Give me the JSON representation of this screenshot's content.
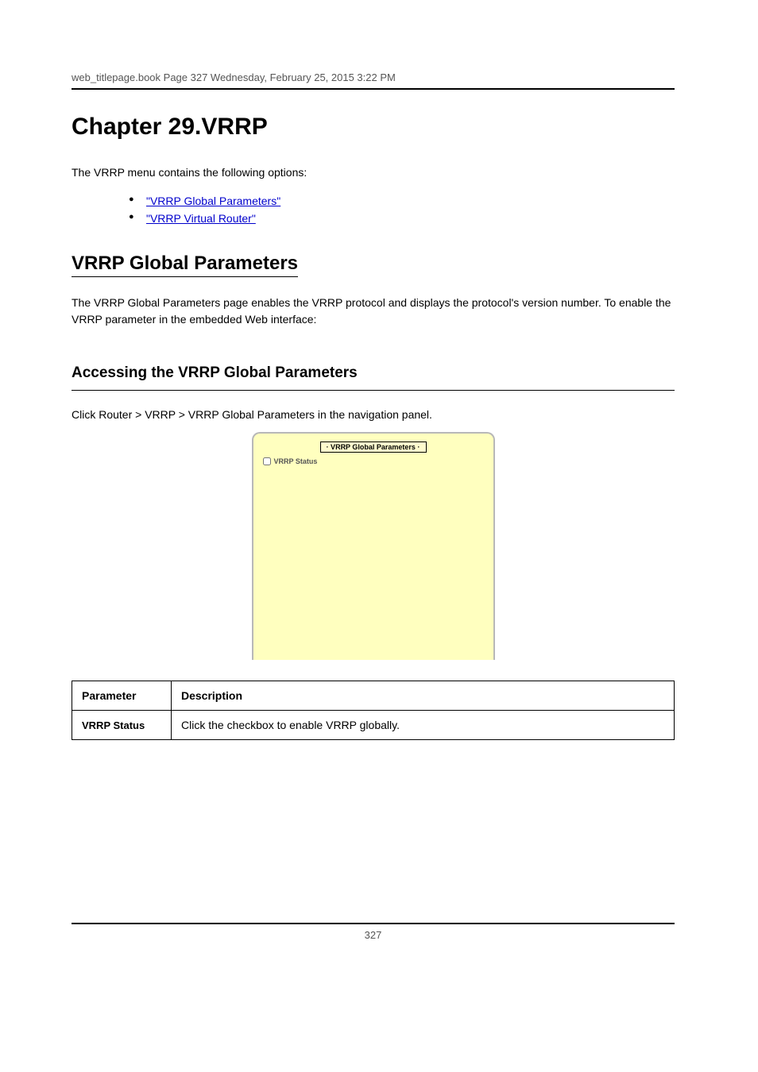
{
  "header": {
    "left": "web_titlepage.book  Page 327  Wednesday, February 25, 2015  3:22 PM",
    "right": ""
  },
  "chapter": {
    "title": "Chapter 29.VRRP"
  },
  "topics": {
    "intro": "The VRRP menu contains the following options:",
    "items": [
      "\"VRRP Global Parameters\"",
      "\"VRRP Virtual Router\""
    ]
  },
  "section": {
    "title": "VRRP Global Parameters",
    "para": "The VRRP Global Parameters page enables the VRRP protocol and displays the protocol's version number. To enable the VRRP parameter in the embedded Web interface:",
    "step": "Click Router > VRRP > VRRP Global Parameters in the navigation panel.",
    "panel": {
      "title": "· VRRP Global Parameters ·",
      "row_label": "VRRP Status"
    },
    "table_head_left": "Parameter",
    "table_head_right": "Description",
    "row1_left": "VRRP Status",
    "row1_right": "Click the checkbox to enable VRRP globally."
  },
  "footer": {
    "page": "327"
  }
}
